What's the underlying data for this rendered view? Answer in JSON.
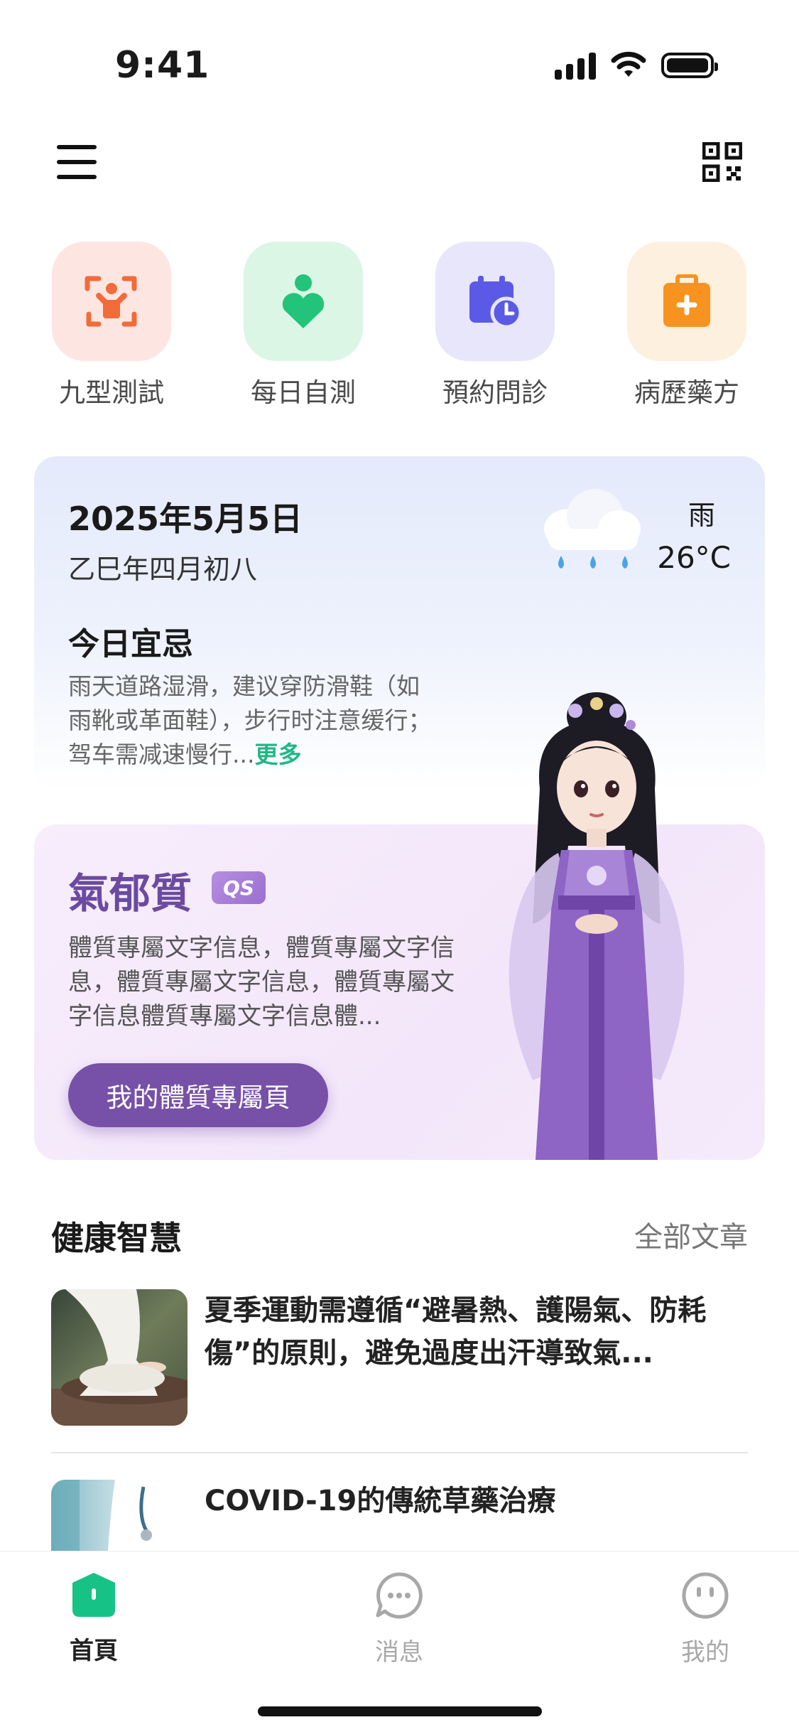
{
  "status_bar": {
    "time": "9:41"
  },
  "quick_actions": [
    {
      "label": "九型測試",
      "icon": "scan-person-icon",
      "color": "#f26b3a",
      "bg": "#fde6e2"
    },
    {
      "label": "每日自測",
      "icon": "heart-person-icon",
      "color": "#22c37a",
      "bg": "#dcf6e6"
    },
    {
      "label": "預約問診",
      "icon": "calendar-clock-icon",
      "color": "#5a5ae6",
      "bg": "#e7e6fb"
    },
    {
      "label": "病歷藥方",
      "icon": "medical-kit-icon",
      "color": "#f7931e",
      "bg": "#fdf0df"
    }
  ],
  "date_card": {
    "date": "2025年5月5日",
    "lunar": "乙巳年四月初八",
    "weather_condition": "雨",
    "temperature": "26°C",
    "yiji_title": "今日宜忌",
    "yiji_text": "雨天道路湿滑，建议穿防滑鞋（如雨靴或革面鞋），步行时注意缓行；驾车需减速慢行...",
    "more": "更多"
  },
  "constitution": {
    "title": "氣郁質",
    "badge": "QS",
    "text": "體質專屬文字信息，體質專屬文字信息，體質專屬文字信息，體質專屬文字信息體質專屬文字信息體...",
    "button": "我的體質專屬頁"
  },
  "articles_section": {
    "title": "健康智慧",
    "all": "全部文章",
    "items": [
      {
        "title": "夏季運動需遵循“避暑熱、護陽氣、防耗傷”的原則，避免過度出汗導致氣..."
      },
      {
        "title": "COVID-19的傳統草藥治療"
      }
    ]
  },
  "tabbar": {
    "tabs": [
      {
        "label": "首頁",
        "icon": "home-icon",
        "active": true
      },
      {
        "label": "消息",
        "icon": "message-icon",
        "active": false
      },
      {
        "label": "我的",
        "icon": "profile-icon",
        "active": false
      }
    ],
    "accent": "#17c286"
  }
}
